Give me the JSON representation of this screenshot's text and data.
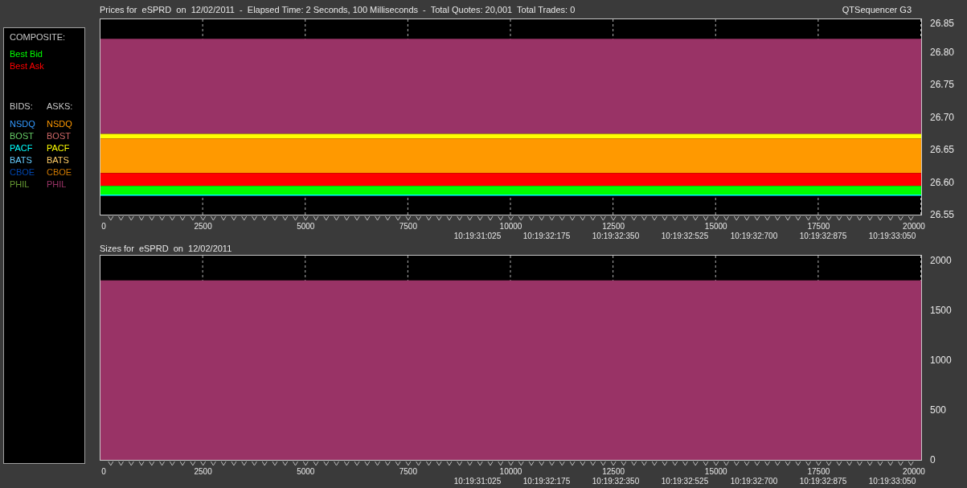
{
  "window": {
    "app_name": "QTSequencer G3"
  },
  "legend": {
    "composite_heading": "COMPOSITE:",
    "composite": [
      {
        "label": "Best Bid",
        "color": "#00ff00"
      },
      {
        "label": "Best Ask",
        "color": "#ff0000"
      }
    ],
    "bids_heading": "BIDS:",
    "asks_heading": "ASKS:",
    "bids": [
      {
        "label": "NSDQ",
        "color": "#3399ff"
      },
      {
        "label": "BOST",
        "color": "#66cc66"
      },
      {
        "label": "PACF",
        "color": "#00ffff"
      },
      {
        "label": "BATS",
        "color": "#66ccff"
      },
      {
        "label": "CBOE",
        "color": "#0044aa"
      },
      {
        "label": "PHIL",
        "color": "#669933"
      }
    ],
    "asks": [
      {
        "label": "NSDQ",
        "color": "#ff9900"
      },
      {
        "label": "BOST",
        "color": "#cc6666"
      },
      {
        "label": "PACF",
        "color": "#ffff00"
      },
      {
        "label": "BATS",
        "color": "#ffcc66"
      },
      {
        "label": "CBOE",
        "color": "#cc7700"
      },
      {
        "label": "PHIL",
        "color": "#993366"
      }
    ]
  },
  "price_panel": {
    "title": "Prices for  eSPRD  on  12/02/2011  -  Elapsed Time: 2 Seconds, 100 Milliseconds  -  Total Quotes: 20,001  Total Trades: 0",
    "chart_data": {
      "type": "area",
      "x": [
        0,
        20000
      ],
      "series": [
        {
          "color": "#993366",
          "values": [
            26.82,
            26.82
          ]
        },
        {
          "color": "#ffff00",
          "values": [
            26.674,
            26.674
          ]
        },
        {
          "color": "#ff9900",
          "values": [
            26.667,
            26.667
          ]
        },
        {
          "color": "#ff0000",
          "values": [
            26.614,
            26.614
          ]
        },
        {
          "color": "#00ff00",
          "values": [
            26.594,
            26.594
          ]
        },
        {
          "color": "#00ffff",
          "values": [
            26.58,
            26.58
          ],
          "type": "line"
        }
      ],
      "grid": true,
      "xlim": [
        0,
        20000
      ],
      "ylim": [
        26.55,
        26.85
      ],
      "xticks": [
        {
          "value": 0,
          "label": "0"
        },
        {
          "value": 2500,
          "label": "2500"
        },
        {
          "value": 5000,
          "label": "5000"
        },
        {
          "value": 7500,
          "label": "7500"
        },
        {
          "value": 10000,
          "label": "10000"
        },
        {
          "value": 12500,
          "label": "12500"
        },
        {
          "value": 15000,
          "label": "15000"
        },
        {
          "value": 17500,
          "label": "17500"
        },
        {
          "value": 20000,
          "label": "20000"
        }
      ],
      "yticks": [
        {
          "value": 26.55,
          "label": "26.55"
        },
        {
          "value": 26.6,
          "label": "26.60"
        },
        {
          "value": 26.65,
          "label": "26.65"
        },
        {
          "value": 26.7,
          "label": "26.70"
        },
        {
          "value": 26.75,
          "label": "26.75"
        },
        {
          "value": 26.8,
          "label": "26.80"
        },
        {
          "value": 26.85,
          "label": "26.85"
        }
      ],
      "annotations": [
        "10:19:31:025",
        "10:19:32:175",
        "10:19:32:350",
        "10:19:32:525",
        "10:19:32:700",
        "10:19:32:875",
        "10:19:33:050"
      ]
    }
  },
  "size_panel": {
    "title": "Sizes for  eSPRD  on  12/02/2011",
    "chart_data": {
      "type": "area",
      "x": [
        0,
        20000
      ],
      "series": [
        {
          "color": "#993366",
          "values": [
            1800,
            1800
          ]
        }
      ],
      "grid": true,
      "xlim": [
        0,
        20000
      ],
      "ylim": [
        0,
        2048
      ],
      "xticks": [
        {
          "value": 0,
          "label": "0"
        },
        {
          "value": 2500,
          "label": "2500"
        },
        {
          "value": 5000,
          "label": "5000"
        },
        {
          "value": 7500,
          "label": "7500"
        },
        {
          "value": 10000,
          "label": "10000"
        },
        {
          "value": 12500,
          "label": "12500"
        },
        {
          "value": 15000,
          "label": "15000"
        },
        {
          "value": 17500,
          "label": "17500"
        },
        {
          "value": 20000,
          "label": "20000"
        }
      ],
      "yticks": [
        {
          "value": 0,
          "label": "0"
        },
        {
          "value": 500,
          "label": "500"
        },
        {
          "value": 1000,
          "label": "1000"
        },
        {
          "value": 1500,
          "label": "1500"
        },
        {
          "value": 2000,
          "label": "2000"
        }
      ],
      "annotations": [
        "10:19:31:025",
        "10:19:32:175",
        "10:19:32:350",
        "10:19:32:525",
        "10:19:32:700",
        "10:19:32:875",
        "10:19:33:050"
      ]
    }
  }
}
